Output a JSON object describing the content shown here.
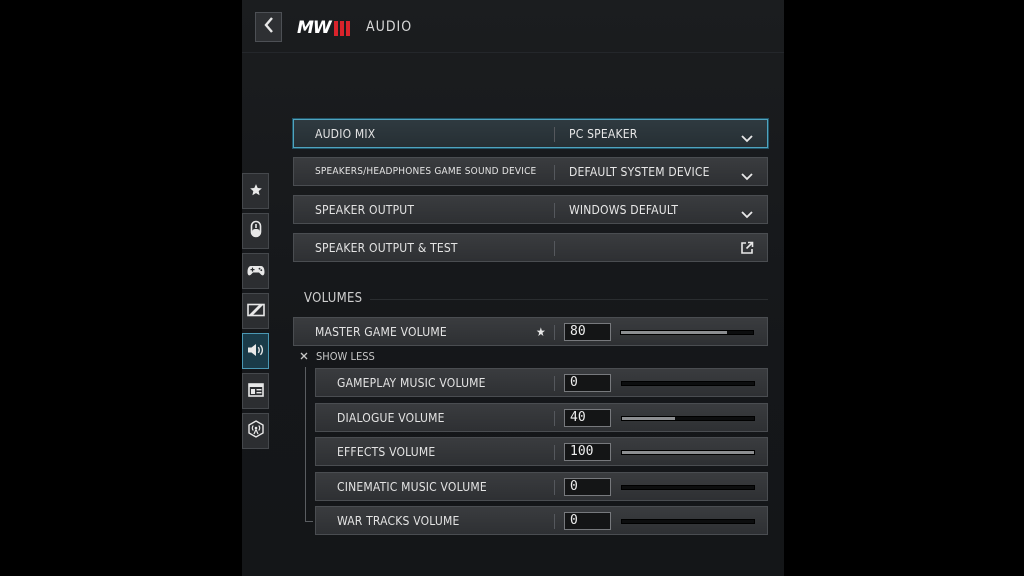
{
  "header": {
    "logo_text": "MW",
    "logo_bars": "III",
    "title": "AUDIO"
  },
  "side_tabs": [
    {
      "icon": "star-icon"
    },
    {
      "icon": "mouse-icon"
    },
    {
      "icon": "gamepad-icon"
    },
    {
      "icon": "display-icon"
    },
    {
      "icon": "speaker-icon"
    },
    {
      "icon": "interface-icon"
    },
    {
      "icon": "network-icon"
    }
  ],
  "settings": {
    "audio_mix": {
      "label": "AUDIO MIX",
      "value": "PC SPEAKER"
    },
    "sound_device": {
      "label": "SPEAKERS/HEADPHONES GAME SOUND DEVICE",
      "value": "DEFAULT SYSTEM DEVICE"
    },
    "speaker_output": {
      "label": "SPEAKER OUTPUT",
      "value": "WINDOWS DEFAULT"
    },
    "speaker_test": {
      "label": "SPEAKER OUTPUT & TEST"
    }
  },
  "volumes": {
    "section_title": "VOLUMES",
    "master": {
      "label": "MASTER GAME VOLUME",
      "value": "80",
      "fraction": 0.8
    },
    "show_less": "SHOW LESS",
    "items": [
      {
        "label": "GAMEPLAY MUSIC VOLUME",
        "value": "0",
        "fraction": 0
      },
      {
        "label": "DIALOGUE VOLUME",
        "value": "40",
        "fraction": 0.4
      },
      {
        "label": "EFFECTS VOLUME",
        "value": "100",
        "fraction": 1
      },
      {
        "label": "CINEMATIC MUSIC VOLUME",
        "value": "0",
        "fraction": 0
      },
      {
        "label": "WAR TRACKS VOLUME",
        "value": "0",
        "fraction": 0
      }
    ]
  },
  "colors": {
    "accent": "#4fa4bf",
    "brand_red": "#d9232b"
  }
}
